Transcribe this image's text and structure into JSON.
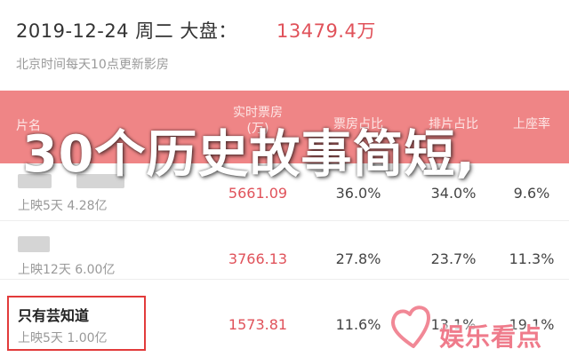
{
  "header": {
    "date": "2019-12-24 周二 大盘：",
    "total": "13479.4万",
    "subline": "北京时间每天10点更新影房"
  },
  "columns": {
    "name": "片名",
    "box": "实时票房",
    "box_unit": "(万)",
    "share1": "票房占比",
    "share2": "排片占比",
    "share3": "上座率"
  },
  "rows": [
    {
      "title": "",
      "sub": "上映5天  4.28亿",
      "box": "5661.09",
      "share1": "36.0%",
      "share2": "34.0%",
      "share3": "9.6%"
    },
    {
      "title": "",
      "sub": "上映12天  6.00亿",
      "box": "3766.13",
      "share1": "27.8%",
      "share2": "23.7%",
      "share3": "11.3%"
    },
    {
      "title": "只有芸知道",
      "sub": "上映5天  1.00亿",
      "box": "1573.81",
      "share1": "11.6%",
      "share2": "13.1%",
      "share3": "19.1%"
    }
  ],
  "overlay": {
    "title": "30个历史故事简短,"
  },
  "watermark": {
    "text": "娱乐看点",
    "color": "#ef7b8b"
  },
  "colors": {
    "accent": "#e0525a",
    "header_band": "#ef8586"
  }
}
